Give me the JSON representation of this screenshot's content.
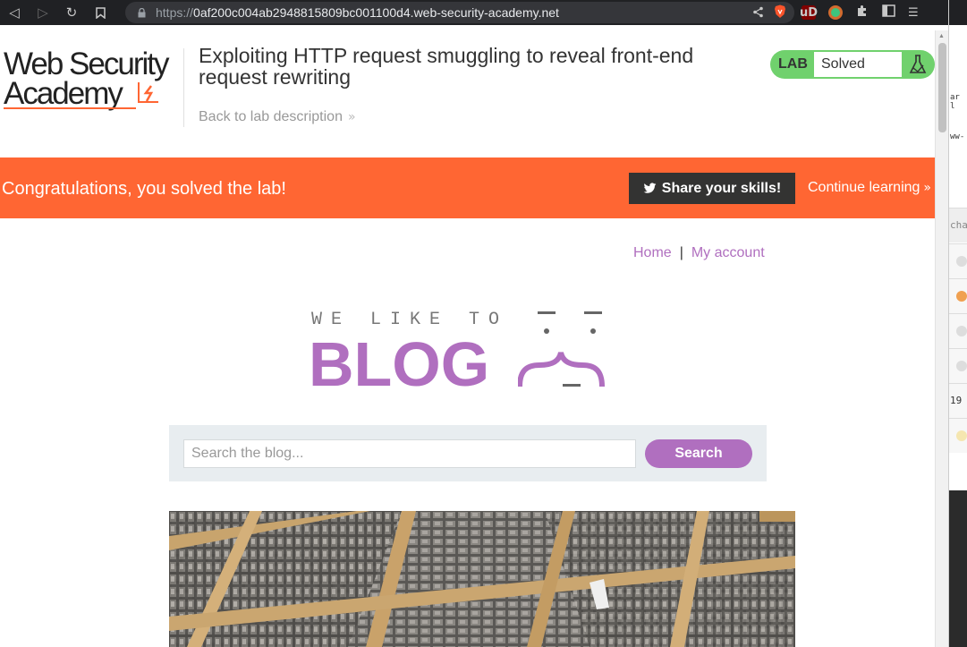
{
  "browser": {
    "url_scheme": "https://",
    "url_host": "0af200c004ab2948815809bc001100d4.web-security-academy.net",
    "ublock_label": "uD"
  },
  "header": {
    "logo_line1": "Web Security",
    "logo_line2": "Academy",
    "lab_title": "Exploiting HTTP request smuggling to reveal front-end request rewriting",
    "back_link": "Back to lab description",
    "lab_badge_label": "LAB",
    "lab_status": "Solved"
  },
  "banner": {
    "congrats": "Congratulations, you solved the lab!",
    "share_button": "Share your skills!",
    "continue_link": "Continue learning"
  },
  "nav": {
    "home": "Home",
    "separator": "|",
    "my_account": "My account"
  },
  "blog": {
    "tagline": "WE LIKE TO",
    "word": "BLOG"
  },
  "search": {
    "placeholder": "Search the blog...",
    "button": "Search"
  },
  "side_panel": {
    "snippet1": "ar l",
    "snippet2": "ww-",
    "snippet3": "cha",
    "snippet4": "19"
  },
  "colors": {
    "brand_orange": "#ff6633",
    "blog_purple": "#b06fbf",
    "lab_green": "#70d16d"
  }
}
